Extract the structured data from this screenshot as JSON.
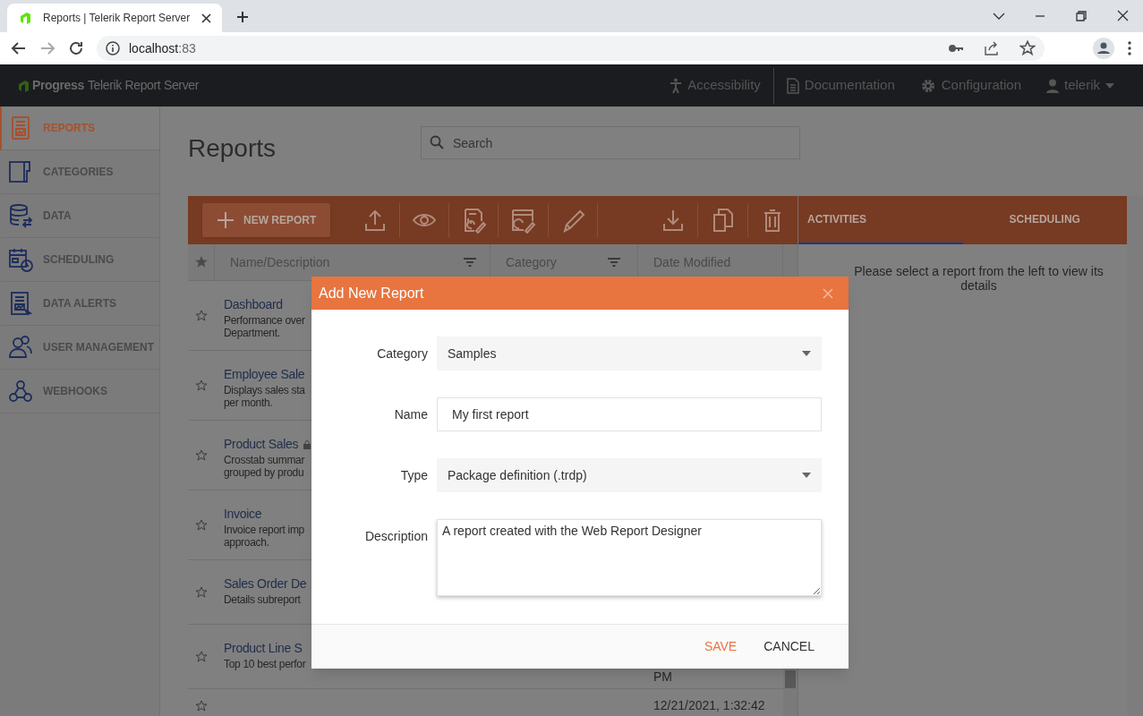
{
  "browser": {
    "tab_title": "Reports | Telerik Report Server",
    "url_host": "localhost",
    "url_port": ":83"
  },
  "header": {
    "brand": "Progress",
    "product": "Telerik Report Server",
    "links": [
      {
        "kind": "accessibility",
        "label": "Accessibility"
      },
      {
        "kind": "documentation",
        "label": "Documentation"
      },
      {
        "kind": "configuration",
        "label": "Configuration"
      }
    ],
    "user": "telerik"
  },
  "sidebar": {
    "items": [
      {
        "kind": "reports",
        "label": "REPORTS",
        "selected": true
      },
      {
        "kind": "categories",
        "label": "CATEGORIES",
        "selected": false
      },
      {
        "kind": "data",
        "label": "DATA",
        "selected": false
      },
      {
        "kind": "scheduling",
        "label": "SCHEDULING",
        "selected": false
      },
      {
        "kind": "alerts",
        "label": "DATA ALERTS",
        "selected": false
      },
      {
        "kind": "users",
        "label": "USER MANAGEMENT",
        "selected": false
      },
      {
        "kind": "webhooks",
        "label": "WEBHOOKS",
        "selected": false
      }
    ]
  },
  "page": {
    "title": "Reports",
    "search": {
      "placeholder": "Search"
    }
  },
  "toolbar": {
    "new_button": "NEW REPORT"
  },
  "table": {
    "columns": [
      "Name/Description",
      "Category",
      "Date Modified"
    ],
    "rows": [
      {
        "name": "Dashboard",
        "description": [
          "Performance over",
          "Department."
        ],
        "locked": false,
        "date": ""
      },
      {
        "name": "Employee Sale",
        "description": [
          "Displays sales sta",
          "per month."
        ],
        "locked": false,
        "date": ""
      },
      {
        "name": "Product Sales",
        "description": [
          "Crosstab summar",
          "grouped by produ"
        ],
        "locked": true,
        "date": ""
      },
      {
        "name": "Invoice",
        "description": [
          "Invoice report imp",
          "approach."
        ],
        "locked": false,
        "date": ""
      },
      {
        "name": "Sales Order De",
        "description": [
          "Details subreport"
        ],
        "date": ""
      },
      {
        "name": "Product Line S",
        "description": [
          "Top 10 best perfor"
        ],
        "locked": false,
        "date": "PM"
      },
      {
        "name": "",
        "description": [],
        "date": "12/21/2021, 1:32:42"
      }
    ]
  },
  "side_panel": {
    "tabs": [
      {
        "label": "ACTIVITIES",
        "selected": true
      },
      {
        "label": "SCHEDULING",
        "selected": false
      }
    ],
    "message": "Please select a report from the left to view its details"
  },
  "dialog": {
    "title": "Add New Report",
    "fields": [
      {
        "kind": "select",
        "label": "Category",
        "value": "Samples"
      },
      {
        "kind": "text",
        "label": "Name",
        "value": "My first report"
      },
      {
        "kind": "select",
        "label": "Type",
        "value": "Package definition (.trdp)"
      },
      {
        "kind": "textarea",
        "label": "Description",
        "value": "A report created with the Web Report Designer"
      }
    ],
    "buttons": [
      {
        "kind": "primary",
        "label": "SAVE"
      },
      {
        "kind": "secondary",
        "label": "CANCEL"
      }
    ]
  }
}
